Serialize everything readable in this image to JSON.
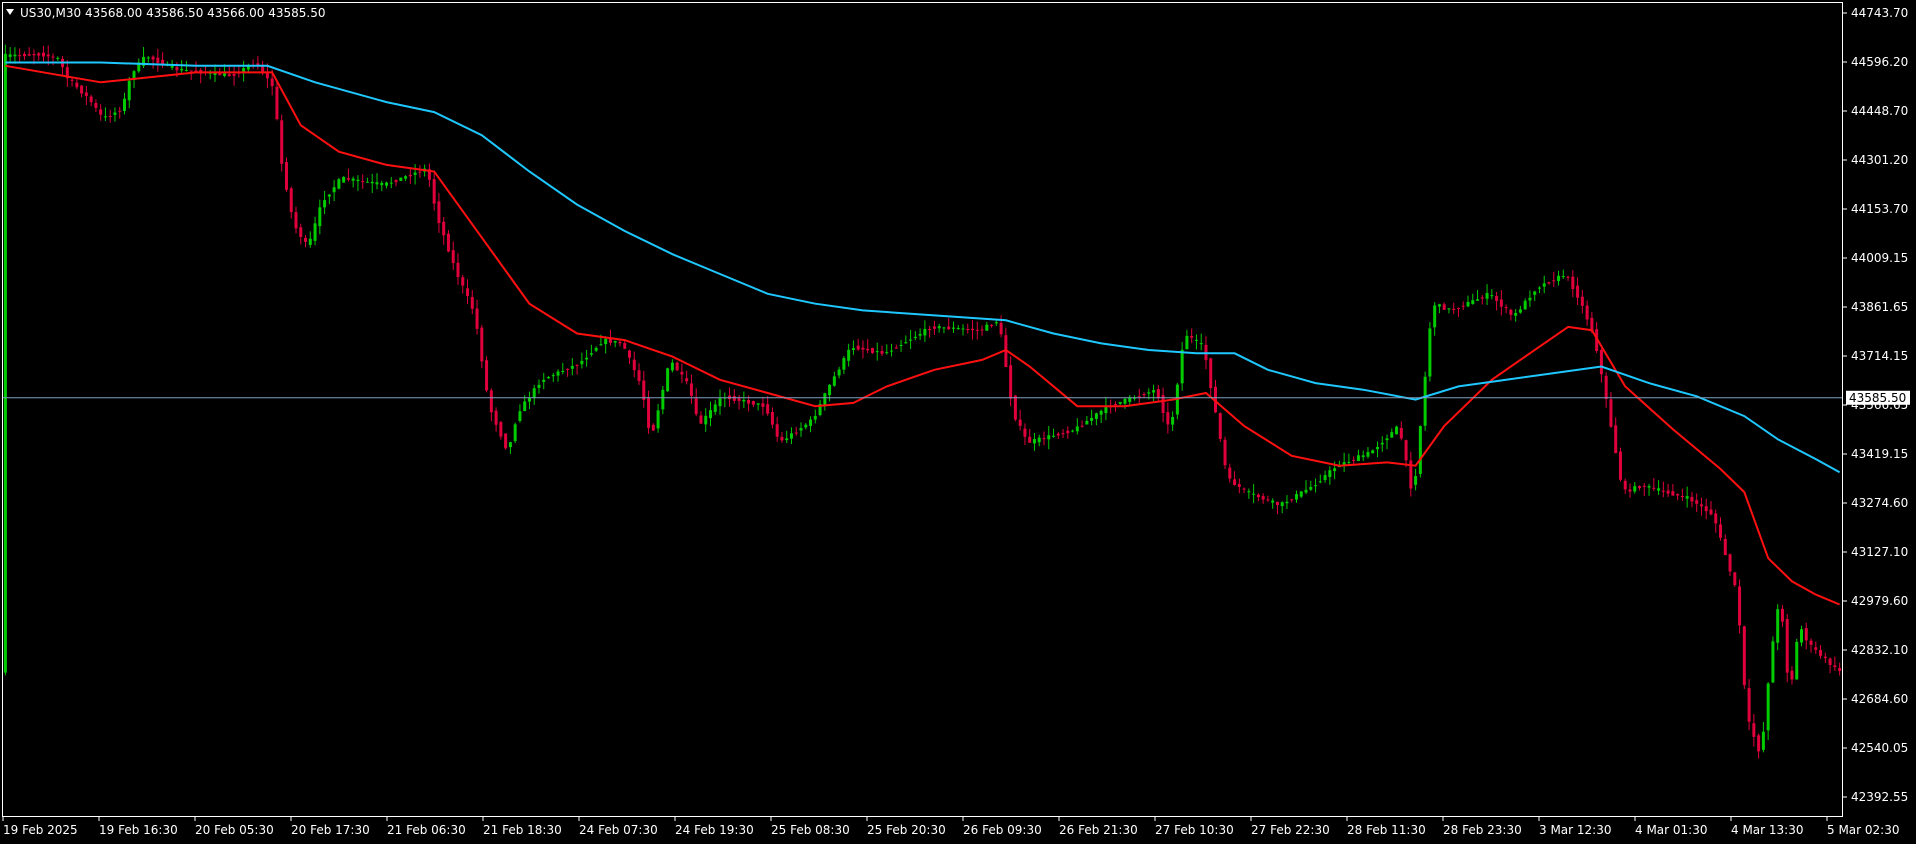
{
  "header": {
    "symbol_label": "US30,M30",
    "ohlc_text": "43568.00 43586.50 43566.00 43585.50",
    "menu_arrow": "down-triangle-icon"
  },
  "colors": {
    "background": "#000000",
    "frame": "#ffffff",
    "bull_candle": "#00cc00",
    "bear_candle": "#e0003c",
    "ma_fast": "#ff1010",
    "ma_slow": "#1ec8ff",
    "bid_line": "#7f9fbf",
    "text": "#ffffff"
  },
  "chart_data": {
    "type": "candlestick",
    "symbol": "US30",
    "timeframe": "M30",
    "last_price": 43585.5,
    "last_price_label": "43585.50",
    "ylim": [
      42320,
      44780
    ],
    "y_tick_labels": [
      "44743.70",
      "44596.20",
      "44448.70",
      "44301.20",
      "44153.70",
      "44009.15",
      "43861.65",
      "43714.15",
      "43566.65",
      "43419.15",
      "43274.60",
      "43127.10",
      "42979.60",
      "42832.10",
      "42684.60",
      "42540.05",
      "42392.55"
    ],
    "x_tick_labels": [
      "19 Feb 2025",
      "19 Feb 16:30",
      "20 Feb 05:30",
      "20 Feb 17:30",
      "21 Feb 06:30",
      "21 Feb 18:30",
      "24 Feb 07:30",
      "24 Feb 19:30",
      "25 Feb 08:30",
      "25 Feb 20:30",
      "26 Feb 09:30",
      "26 Feb 21:30",
      "27 Feb 10:30",
      "27 Feb 22:30",
      "28 Feb 11:30",
      "28 Feb 23:30",
      "3 Mar 12:30",
      "4 Mar 01:30",
      "4 Mar 13:30",
      "5 Mar 02:30"
    ],
    "price_path": [
      [
        0,
        44620
      ],
      [
        8,
        44625
      ],
      [
        12,
        44610
      ],
      [
        13,
        44560
      ],
      [
        18,
        44490
      ],
      [
        21,
        44430
      ],
      [
        25,
        44460
      ],
      [
        27,
        44570
      ],
      [
        30,
        44620
      ],
      [
        36,
        44580
      ],
      [
        48,
        44560
      ],
      [
        53,
        44600
      ],
      [
        57,
        44520
      ],
      [
        58,
        44330
      ],
      [
        61,
        44110
      ],
      [
        64,
        44040
      ],
      [
        67,
        44180
      ],
      [
        71,
        44250
      ],
      [
        80,
        44230
      ],
      [
        89,
        44280
      ],
      [
        91,
        44140
      ],
      [
        95,
        43970
      ],
      [
        99,
        43840
      ],
      [
        102,
        43560
      ],
      [
        106,
        43420
      ],
      [
        108,
        43540
      ],
      [
        113,
        43640
      ],
      [
        121,
        43690
      ],
      [
        126,
        43760
      ],
      [
        130,
        43750
      ],
      [
        134,
        43620
      ],
      [
        136,
        43460
      ],
      [
        140,
        43700
      ],
      [
        144,
        43620
      ],
      [
        146,
        43500
      ],
      [
        151,
        43590
      ],
      [
        160,
        43560
      ],
      [
        163,
        43450
      ],
      [
        170,
        43520
      ],
      [
        173,
        43610
      ],
      [
        178,
        43740
      ],
      [
        185,
        43720
      ],
      [
        195,
        43800
      ],
      [
        205,
        43790
      ],
      [
        209,
        43820
      ],
      [
        212,
        43540
      ],
      [
        215,
        43450
      ],
      [
        225,
        43490
      ],
      [
        232,
        43560
      ],
      [
        242,
        43610
      ],
      [
        245,
        43480
      ],
      [
        248,
        43780
      ],
      [
        252,
        43740
      ],
      [
        254,
        43580
      ],
      [
        257,
        43340
      ],
      [
        261,
        43300
      ],
      [
        268,
        43260
      ],
      [
        275,
        43320
      ],
      [
        280,
        43380
      ],
      [
        287,
        43420
      ],
      [
        293,
        43500
      ],
      [
        296,
        43280
      ],
      [
        300,
        43870
      ],
      [
        304,
        43850
      ],
      [
        312,
        43900
      ],
      [
        317,
        43830
      ],
      [
        322,
        43920
      ],
      [
        328,
        43960
      ],
      [
        331,
        43880
      ],
      [
        334,
        43770
      ],
      [
        337,
        43540
      ],
      [
        340,
        43300
      ],
      [
        344,
        43320
      ],
      [
        349,
        43300
      ],
      [
        354,
        43280
      ],
      [
        359,
        43230
      ],
      [
        364,
        42990
      ],
      [
        366,
        42620
      ],
      [
        369,
        42500
      ],
      [
        371,
        42800
      ],
      [
        373,
        42990
      ],
      [
        375,
        42680
      ],
      [
        377,
        42900
      ],
      [
        379,
        42840
      ],
      [
        382,
        42800
      ],
      [
        385,
        42760
      ]
    ],
    "series": [
      {
        "style": "moving-average-fast",
        "color": "#ff1010",
        "points": [
          [
            0,
            44590
          ],
          [
            20,
            44540
          ],
          [
            40,
            44570
          ],
          [
            56,
            44570
          ],
          [
            62,
            44410
          ],
          [
            70,
            44330
          ],
          [
            80,
            44290
          ],
          [
            90,
            44270
          ],
          [
            100,
            44070
          ],
          [
            110,
            43870
          ],
          [
            120,
            43780
          ],
          [
            130,
            43760
          ],
          [
            140,
            43710
          ],
          [
            150,
            43640
          ],
          [
            160,
            43600
          ],
          [
            170,
            43560
          ],
          [
            178,
            43570
          ],
          [
            185,
            43620
          ],
          [
            195,
            43670
          ],
          [
            205,
            43700
          ],
          [
            210,
            43730
          ],
          [
            215,
            43680
          ],
          [
            225,
            43560
          ],
          [
            235,
            43560
          ],
          [
            245,
            43580
          ],
          [
            252,
            43600
          ],
          [
            260,
            43500
          ],
          [
            270,
            43410
          ],
          [
            280,
            43380
          ],
          [
            290,
            43390
          ],
          [
            296,
            43380
          ],
          [
            302,
            43500
          ],
          [
            312,
            43640
          ],
          [
            320,
            43720
          ],
          [
            328,
            43800
          ],
          [
            333,
            43790
          ],
          [
            340,
            43620
          ],
          [
            350,
            43490
          ],
          [
            360,
            43370
          ],
          [
            365,
            43300
          ],
          [
            370,
            43100
          ],
          [
            375,
            43030
          ],
          [
            380,
            42990
          ],
          [
            385,
            42960
          ]
        ]
      },
      {
        "style": "moving-average-slow",
        "color": "#1ec8ff",
        "points": [
          [
            0,
            44600
          ],
          [
            20,
            44600
          ],
          [
            40,
            44590
          ],
          [
            55,
            44590
          ],
          [
            65,
            44540
          ],
          [
            80,
            44480
          ],
          [
            90,
            44450
          ],
          [
            100,
            44380
          ],
          [
            110,
            44270
          ],
          [
            120,
            44170
          ],
          [
            130,
            44090
          ],
          [
            140,
            44020
          ],
          [
            150,
            43960
          ],
          [
            160,
            43900
          ],
          [
            170,
            43870
          ],
          [
            180,
            43850
          ],
          [
            190,
            43840
          ],
          [
            200,
            43830
          ],
          [
            210,
            43820
          ],
          [
            220,
            43780
          ],
          [
            230,
            43750
          ],
          [
            240,
            43730
          ],
          [
            250,
            43720
          ],
          [
            258,
            43720
          ],
          [
            265,
            43670
          ],
          [
            275,
            43630
          ],
          [
            285,
            43610
          ],
          [
            296,
            43580
          ],
          [
            305,
            43620
          ],
          [
            315,
            43640
          ],
          [
            325,
            43660
          ],
          [
            335,
            43680
          ],
          [
            345,
            43630
          ],
          [
            355,
            43590
          ],
          [
            365,
            43530
          ],
          [
            372,
            43460
          ],
          [
            380,
            43400
          ],
          [
            385,
            43360
          ]
        ]
      }
    ]
  }
}
